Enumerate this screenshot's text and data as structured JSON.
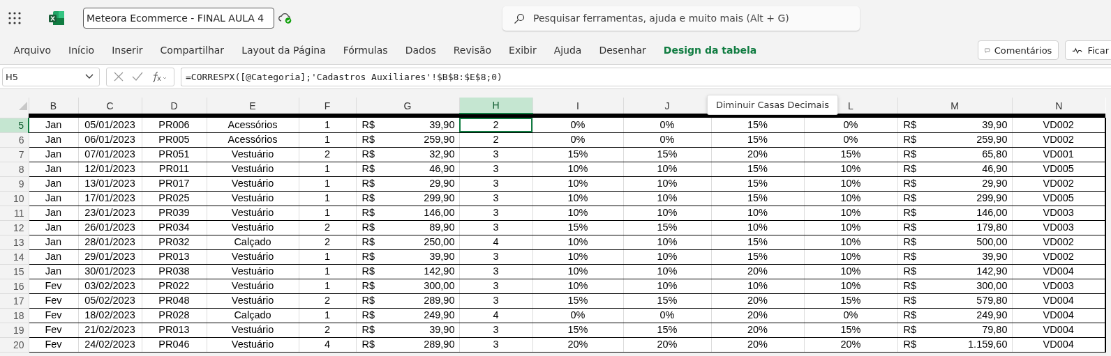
{
  "app": {
    "document_title": "Meteora Ecommerce - FINAL AULA 4",
    "search_placeholder": "Pesquisar ferramentas, ajuda e muito mais (Alt + G)"
  },
  "ribbon_tabs": [
    {
      "label": "Arquivo",
      "kind": "standard"
    },
    {
      "label": "Início",
      "kind": "standard"
    },
    {
      "label": "Inserir",
      "kind": "standard"
    },
    {
      "label": "Compartilhar",
      "kind": "standard"
    },
    {
      "label": "Layout da Página",
      "kind": "standard"
    },
    {
      "label": "Fórmulas",
      "kind": "standard"
    },
    {
      "label": "Dados",
      "kind": "standard"
    },
    {
      "label": "Revisão",
      "kind": "standard"
    },
    {
      "label": "Exibir",
      "kind": "standard"
    },
    {
      "label": "Ajuda",
      "kind": "standard"
    },
    {
      "label": "Desenhar",
      "kind": "standard"
    },
    {
      "label": "Design da tabela",
      "kind": "contextual"
    }
  ],
  "ribbon_buttons": [
    {
      "label": "Comentários",
      "kind": "comments"
    },
    {
      "label": "Ficar",
      "kind": "catch-up"
    }
  ],
  "formula_bar": {
    "name_box": "H5",
    "formula": "=CORRESPX([@Categoria];'Cadastros Auxiliares'!$B$8:$E$8;0)"
  },
  "sheet": {
    "columns": [
      {
        "label": "B",
        "selected": false
      },
      {
        "label": "C",
        "selected": false
      },
      {
        "label": "D",
        "selected": false
      },
      {
        "label": "E",
        "selected": false
      },
      {
        "label": "F",
        "selected": false
      },
      {
        "label": "G",
        "selected": false
      },
      {
        "label": "H",
        "selected": true
      },
      {
        "label": "I",
        "selected": false
      },
      {
        "label": "J",
        "selected": false
      },
      null,
      {
        "label": "L",
        "selected": false
      },
      {
        "label": "M",
        "selected": false
      },
      {
        "label": "N",
        "selected": false
      }
    ],
    "rows": [
      {
        "number": "5",
        "selected": true,
        "cells": [
          "Jan",
          "05/01/2023",
          "PR006",
          "Acessórios",
          "1",
          [
            "R$",
            "39,90"
          ],
          "2",
          "0%",
          "0%",
          "15%",
          "0%",
          [
            "R$",
            "39,90"
          ],
          "VD002"
        ]
      },
      {
        "number": "6",
        "selected": false,
        "cells": [
          "Jan",
          "06/01/2023",
          "PR005",
          "Acessórios",
          "1",
          [
            "R$",
            "259,90"
          ],
          "2",
          "0%",
          "0%",
          "15%",
          "0%",
          [
            "R$",
            "259,90"
          ],
          "VD002"
        ]
      },
      {
        "number": "7",
        "selected": false,
        "cells": [
          "Jan",
          "07/01/2023",
          "PR051",
          "Vestuário",
          "2",
          [
            "R$",
            "32,90"
          ],
          "3",
          "15%",
          "15%",
          "20%",
          "15%",
          [
            "R$",
            "65,80"
          ],
          "VD001"
        ]
      },
      {
        "number": "8",
        "selected": false,
        "cells": [
          "Jan",
          "12/01/2023",
          "PR011",
          "Vestuário",
          "1",
          [
            "R$",
            "46,90"
          ],
          "3",
          "10%",
          "10%",
          "15%",
          "10%",
          [
            "R$",
            "46,90"
          ],
          "VD005"
        ]
      },
      {
        "number": "9",
        "selected": false,
        "cells": [
          "Jan",
          "13/01/2023",
          "PR017",
          "Vestuário",
          "1",
          [
            "R$",
            "29,90"
          ],
          "3",
          "10%",
          "10%",
          "15%",
          "10%",
          [
            "R$",
            "29,90"
          ],
          "VD002"
        ]
      },
      {
        "number": "10",
        "selected": false,
        "cells": [
          "Jan",
          "17/01/2023",
          "PR025",
          "Vestuário",
          "1",
          [
            "R$",
            "299,90"
          ],
          "3",
          "10%",
          "10%",
          "15%",
          "10%",
          [
            "R$",
            "299,90"
          ],
          "VD005"
        ]
      },
      {
        "number": "11",
        "selected": false,
        "cells": [
          "Jan",
          "23/01/2023",
          "PR039",
          "Vestuário",
          "1",
          [
            "R$",
            "146,00"
          ],
          "3",
          "10%",
          "10%",
          "10%",
          "10%",
          [
            "R$",
            "146,00"
          ],
          "VD003"
        ]
      },
      {
        "number": "12",
        "selected": false,
        "cells": [
          "Jan",
          "26/01/2023",
          "PR034",
          "Vestuário",
          "2",
          [
            "R$",
            "89,90"
          ],
          "3",
          "15%",
          "15%",
          "10%",
          "10%",
          [
            "R$",
            "179,80"
          ],
          "VD003"
        ]
      },
      {
        "number": "13",
        "selected": false,
        "cells": [
          "Jan",
          "28/01/2023",
          "PR032",
          "Calçado",
          "2",
          [
            "R$",
            "250,00"
          ],
          "4",
          "10%",
          "10%",
          "15%",
          "10%",
          [
            "R$",
            "500,00"
          ],
          "VD002"
        ]
      },
      {
        "number": "14",
        "selected": false,
        "cells": [
          "Jan",
          "29/01/2023",
          "PR013",
          "Vestuário",
          "1",
          [
            "R$",
            "39,90"
          ],
          "3",
          "10%",
          "10%",
          "15%",
          "10%",
          [
            "R$",
            "39,90"
          ],
          "VD002"
        ]
      },
      {
        "number": "15",
        "selected": false,
        "cells": [
          "Jan",
          "30/01/2023",
          "PR038",
          "Vestuário",
          "1",
          [
            "R$",
            "142,90"
          ],
          "3",
          "10%",
          "10%",
          "20%",
          "10%",
          [
            "R$",
            "142,90"
          ],
          "VD004"
        ]
      },
      {
        "number": "16",
        "selected": false,
        "cells": [
          "Fev",
          "03/02/2023",
          "PR022",
          "Vestuário",
          "1",
          [
            "R$",
            "300,00"
          ],
          "3",
          "10%",
          "10%",
          "10%",
          "10%",
          [
            "R$",
            "300,00"
          ],
          "VD003"
        ]
      },
      {
        "number": "17",
        "selected": false,
        "cells": [
          "Fev",
          "05/02/2023",
          "PR048",
          "Vestuário",
          "2",
          [
            "R$",
            "289,90"
          ],
          "3",
          "15%",
          "15%",
          "20%",
          "15%",
          [
            "R$",
            "579,80"
          ],
          "VD004"
        ]
      },
      {
        "number": "18",
        "selected": false,
        "cells": [
          "Fev",
          "18/02/2023",
          "PR028",
          "Calçado",
          "1",
          [
            "R$",
            "249,90"
          ],
          "4",
          "0%",
          "0%",
          "20%",
          "0%",
          [
            "R$",
            "249,90"
          ],
          "VD004"
        ]
      },
      {
        "number": "19",
        "selected": false,
        "cells": [
          "Fev",
          "21/02/2023",
          "PR013",
          "Vestuário",
          "2",
          [
            "R$",
            "39,90"
          ],
          "3",
          "15%",
          "15%",
          "20%",
          "15%",
          [
            "R$",
            "79,80"
          ],
          "VD004"
        ]
      },
      {
        "number": "20",
        "selected": false,
        "cells": [
          "Fev",
          "24/02/2023",
          "PR046",
          "Vestuário",
          "4",
          [
            "R$",
            "289,90"
          ],
          "3",
          "20%",
          "20%",
          "20%",
          "20%",
          [
            "R$",
            "1.159,60"
          ],
          "VD004"
        ]
      }
    ]
  },
  "tooltip": "Diminuir Casas Decimais"
}
